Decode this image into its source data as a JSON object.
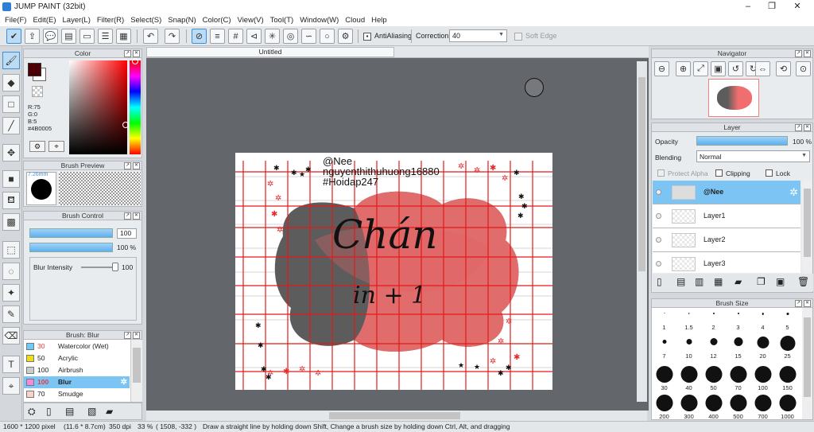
{
  "window": {
    "title": "JUMP PAINT (32bit)",
    "min": "–",
    "max": "❐",
    "close": "✕"
  },
  "menu": [
    "File(F)",
    "Edit(E)",
    "Layer(L)",
    "Filter(R)",
    "Select(S)",
    "Snap(N)",
    "Color(C)",
    "View(V)",
    "Tool(T)",
    "Window(W)",
    "Cloud",
    "Help"
  ],
  "toolbar": {
    "antialias_label": "AntiAliasing",
    "correction_label": "Correction",
    "correction_value": "40",
    "soft_edge_label": "Soft Edge"
  },
  "color_panel": {
    "title": "Color",
    "r": "R:75",
    "g": "G:0",
    "b": "B:5",
    "hex": "#4B0005",
    "main_color": "#4b0005"
  },
  "brush_preview": {
    "title": "Brush Preview",
    "size": "7.26mm"
  },
  "brush_control": {
    "title": "Brush Control",
    "size_value": "100",
    "opacity_value": "100 %",
    "blur_label": "Blur Intensity",
    "blur_value": "100"
  },
  "brush_list": {
    "title": "Brush: Blur",
    "items": [
      {
        "value": "30",
        "label": "Watercolor (Wet)",
        "color": "#6ecbf5"
      },
      {
        "value": "50",
        "label": "Acrylic",
        "color": "#f0dc1a"
      },
      {
        "value": "100",
        "label": "Airbrush",
        "color": "#cccccc"
      },
      {
        "value": "100",
        "label": "Blur",
        "color": "#f08cd8"
      },
      {
        "value": "70",
        "label": "Smudge",
        "color": "#f7d4c4"
      }
    ]
  },
  "document": {
    "tab": "Untitled"
  },
  "artwork": {
    "handle": "@Nee",
    "user": "nguyenthithuhuong16880",
    "tag": "#Hoidap247",
    "script_line1": "Chán",
    "script_line2": "in + 1"
  },
  "navigator": {
    "title": "Navigator"
  },
  "layer_panel": {
    "title": "Layer",
    "opacity_label": "Opacity",
    "opacity_value": "100 %",
    "blending_label": "Blending",
    "blending_value": "Normal",
    "protect_alpha": "Protect Alpha",
    "clipping": "Clipping",
    "lock": "Lock",
    "layers": [
      {
        "name": "@Nee",
        "selected": true
      },
      {
        "name": "Layer1",
        "selected": false
      },
      {
        "name": "Layer2",
        "selected": false
      },
      {
        "name": "Layer3",
        "selected": false
      }
    ]
  },
  "brush_size": {
    "title": "Brush Size",
    "sizes": [
      "1",
      "1.5",
      "2",
      "3",
      "4",
      "5",
      "7",
      "10",
      "12",
      "15",
      "20",
      "25",
      "30",
      "40",
      "50",
      "70",
      "100",
      "150",
      "200",
      "300",
      "400",
      "500",
      "700",
      "1000"
    ]
  },
  "status": {
    "dimensions": "1600 * 1200 pixel",
    "physical": "(11.6 * 8.7cm)",
    "dpi": "350 dpi",
    "zoom": "33 %",
    "coords": "( 1508, -332 )",
    "hint": "Draw a straight line by holding down Shift, Change a brush size by holding down Ctrl, Alt, and dragging"
  }
}
